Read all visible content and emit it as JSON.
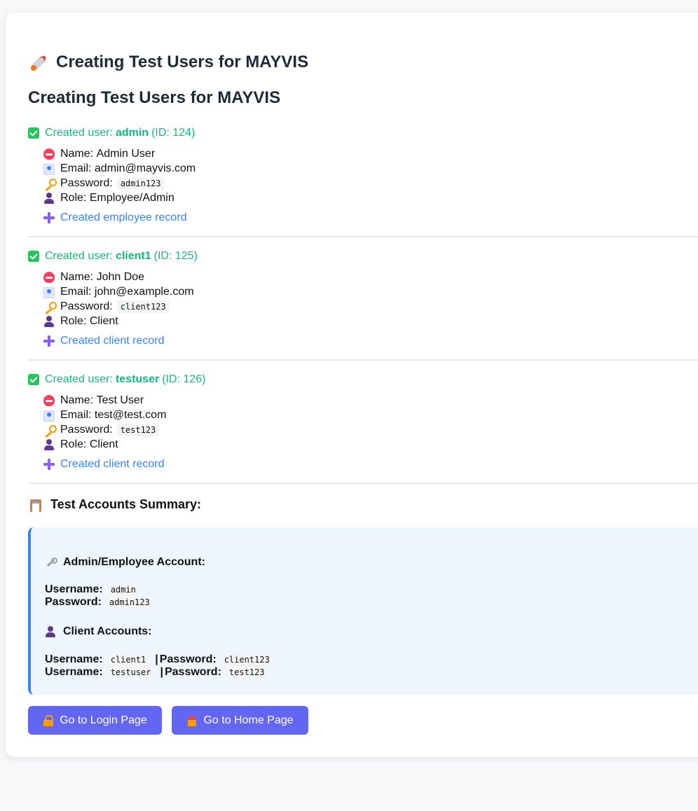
{
  "page": {
    "title": "Creating Test Users for MAYVIS",
    "subtitle": "Creating Test Users for MAYVIS"
  },
  "users": [
    {
      "created_prefix": "Created user:",
      "username": "admin",
      "id_text": "(ID: 124)",
      "name_label": "Name:",
      "name": "Admin User",
      "email_label": "Email:",
      "email": "admin@mayvis.com",
      "password_label": "Password:",
      "password": "admin123",
      "role_label": "Role:",
      "role": "Employee/Admin",
      "record_text": "Created employee record"
    },
    {
      "created_prefix": "Created user:",
      "username": "client1",
      "id_text": "(ID: 125)",
      "name_label": "Name:",
      "name": "John Doe",
      "email_label": "Email:",
      "email": "john@example.com",
      "password_label": "Password:",
      "password": "client123",
      "role_label": "Role:",
      "role": "Client",
      "record_text": "Created client record"
    },
    {
      "created_prefix": "Created user:",
      "username": "testuser",
      "id_text": "(ID: 126)",
      "name_label": "Name:",
      "name": "Test User",
      "email_label": "Email:",
      "email": "test@test.com",
      "password_label": "Password:",
      "password": "test123",
      "role_label": "Role:",
      "role": "Client",
      "record_text": "Created client record"
    }
  ],
  "summary": {
    "title": "Test Accounts Summary:",
    "admin_heading": "Admin/Employee Account:",
    "admin_username_label": "Username:",
    "admin_username": "admin",
    "admin_password_label": "Password:",
    "admin_password": "admin123",
    "client_heading": "Client Accounts:",
    "clients": [
      {
        "username_label": "Username:",
        "username": "client1",
        "sep": "|",
        "password_label": "Password:",
        "password": "client123"
      },
      {
        "username_label": "Username:",
        "username": "testuser",
        "sep": "|",
        "password_label": "Password:",
        "password": "test123"
      }
    ]
  },
  "buttons": {
    "login": "Go to Login Page",
    "home": "Go to Home Page"
  },
  "icons": {
    "title": "rocket-icon",
    "created": "check-icon",
    "name": "name-badge-icon",
    "email": "email-icon",
    "password": "key-icon",
    "role": "person-icon",
    "record": "plus-icon",
    "summary": "clipboard-icon",
    "admin": "wrench-icon",
    "client": "person-icon",
    "login": "lock-icon",
    "home": "house-icon"
  },
  "colors": {
    "success": "#10b981",
    "link": "#3b82f6",
    "button": "#6366f1",
    "summary_bg": "#eff6ff",
    "summary_border": "#3b82f6"
  }
}
